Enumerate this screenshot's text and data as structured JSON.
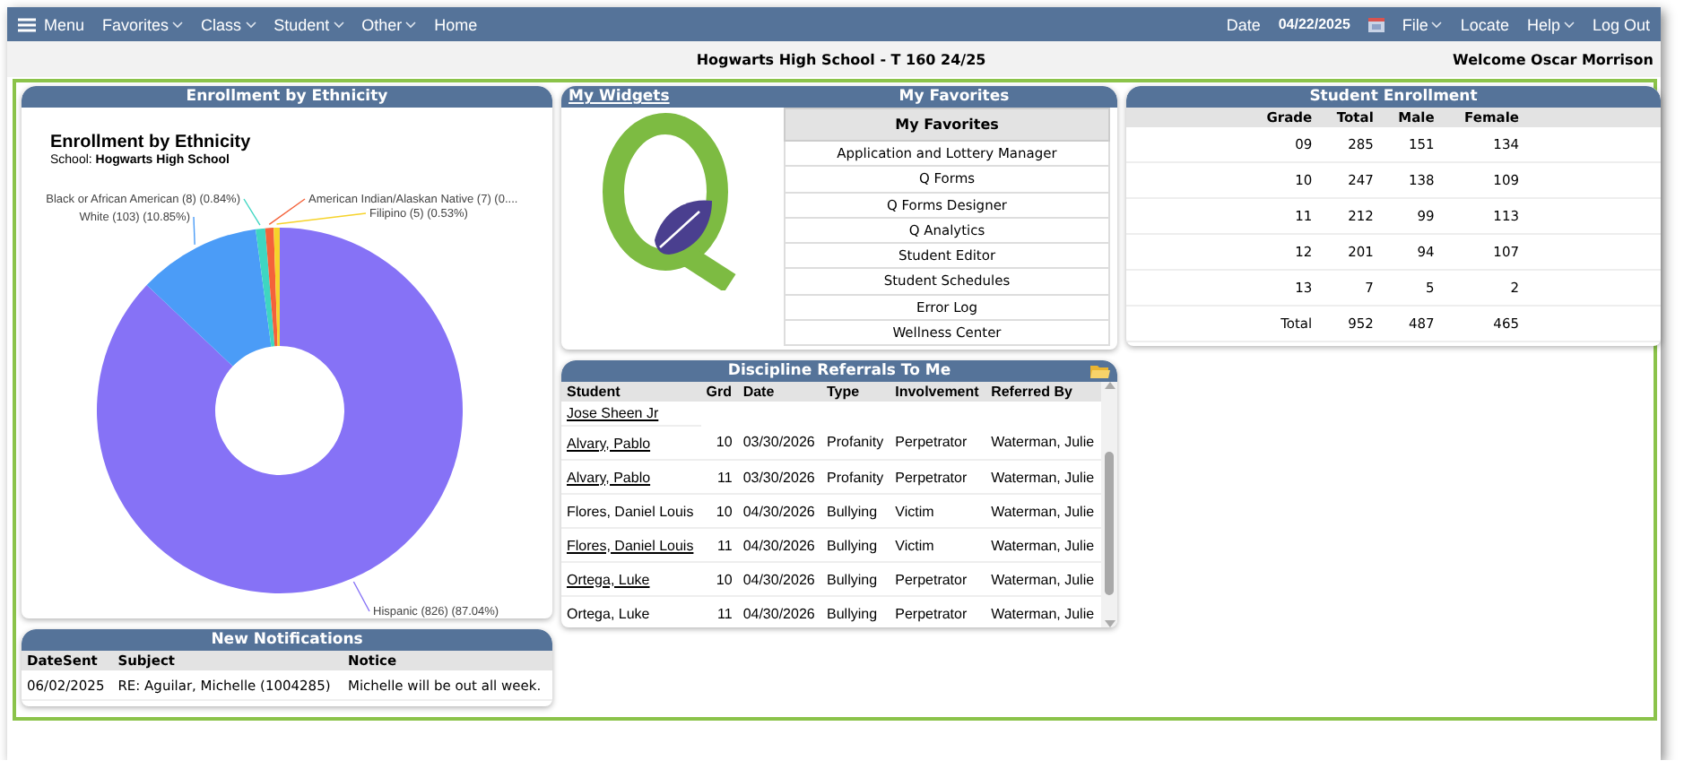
{
  "nav": {
    "menu": "Menu",
    "items": [
      {
        "label": "Favorites",
        "dropdown": true
      },
      {
        "label": "Class",
        "dropdown": true
      },
      {
        "label": "Student",
        "dropdown": true
      },
      {
        "label": "Other",
        "dropdown": true
      },
      {
        "label": "Home",
        "dropdown": false
      }
    ],
    "date_label": "Date",
    "date": "04/22/2025",
    "right_items": [
      {
        "label": "File",
        "dropdown": true
      },
      {
        "label": "Locate",
        "dropdown": false
      },
      {
        "label": "Help",
        "dropdown": true
      },
      {
        "label": "Log Out",
        "dropdown": false
      }
    ]
  },
  "header": {
    "title": "Hogwarts High School - T 160 24/25",
    "welcome": "Welcome Oscar Morrison"
  },
  "ethnicity": {
    "title": "Enrollment by Ethnicity",
    "chart_title": "Enrollment by Ethnicity",
    "subtitle": "School: **Hogwarts High School**",
    "chart_data": {
      "type": "donut",
      "values": [
        87.04,
        10.85,
        0.84,
        0.74,
        0.53
      ],
      "colors": [
        "#8672f6",
        "#4b9cf7",
        "#3ed6c2",
        "#f4623a",
        "#f6d32a"
      ],
      "value_labels": [
        "Hispanic (826) (87.04%)",
        "White (103) (10.85%)",
        "Black or African American (8) (0.84%)",
        "American Indian/Alaskan Native (7) (0....",
        "Filipino (5) (0.53%)"
      ]
    }
  },
  "notifications": {
    "title": "New Notifications",
    "columns": [
      "DateSent",
      "Subject",
      "Notice"
    ],
    "rows": [
      [
        "06/02/2025",
        "RE: Aguilar, Michelle (1004285)",
        "Michelle will be out all week."
      ]
    ]
  },
  "widgets": {
    "link": "My Widgets",
    "title": "My Favorites",
    "favorites_header": "My Favorites",
    "favorites": [
      "Application and Lottery Manager",
      "Q Forms",
      "Q Forms Designer",
      "Q Analytics",
      "Student Editor",
      "Student Schedules",
      "Error Log",
      "Wellness Center"
    ]
  },
  "discipline": {
    "title": "Discipline Referrals To Me",
    "columns": [
      "Student",
      "Grd",
      "Date",
      "Type",
      "Involvement",
      "Referred By"
    ],
    "rows": [
      {
        "kind": "continued",
        "student": "Jose Sheen Jr",
        "linked": true
      },
      {
        "kind": "full",
        "student": "Alvary, Pablo",
        "linked": true,
        "grd": "10",
        "date": "03/30/2026",
        "type": "Profanity",
        "involvement": "Perpetrator",
        "referred_by": "Waterman, Julie"
      },
      {
        "kind": "full",
        "student": "Alvary, Pablo",
        "linked": true,
        "grd": "11",
        "date": "03/30/2026",
        "type": "Profanity",
        "involvement": "Perpetrator",
        "referred_by": "Waterman, Julie"
      },
      {
        "kind": "full",
        "student": "Flores, Daniel Louis",
        "linked": false,
        "grd": "10",
        "date": "04/30/2026",
        "type": "Bullying",
        "involvement": "Victim",
        "referred_by": "Waterman, Julie"
      },
      {
        "kind": "full",
        "student": "Flores, Daniel Louis",
        "linked": true,
        "grd": "11",
        "date": "04/30/2026",
        "type": "Bullying",
        "involvement": "Victim",
        "referred_by": "Waterman, Julie"
      },
      {
        "kind": "full",
        "student": "Ortega, Luke",
        "linked": true,
        "grd": "10",
        "date": "04/30/2026",
        "type": "Bullying",
        "involvement": "Perpetrator",
        "referred_by": "Waterman, Julie"
      },
      {
        "kind": "full",
        "student": "Ortega, Luke",
        "linked": false,
        "grd": "11",
        "date": "04/30/2026",
        "type": "Bullying",
        "involvement": "Perpetrator",
        "referred_by": "Waterman, Julie"
      }
    ]
  },
  "enrollment": {
    "title": "Student Enrollment",
    "columns": [
      "Grade",
      "Total",
      "Male",
      "Female"
    ],
    "rows": [
      [
        "09",
        "285",
        "151",
        "134"
      ],
      [
        "10",
        "247",
        "138",
        "109"
      ],
      [
        "11",
        "212",
        "99",
        "113"
      ],
      [
        "12",
        "201",
        "94",
        "107"
      ],
      [
        "13",
        "7",
        "5",
        "2"
      ],
      [
        "Total",
        "952",
        "487",
        "465"
      ]
    ]
  }
}
